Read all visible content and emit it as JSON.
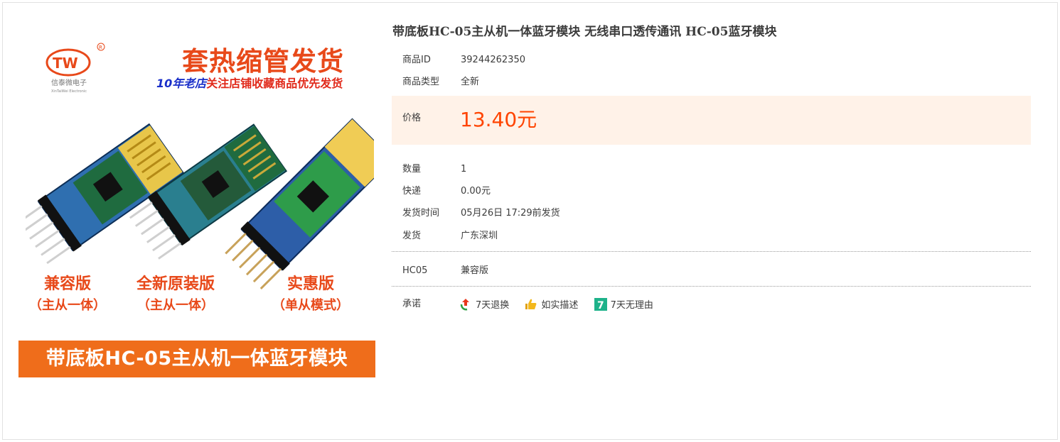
{
  "product": {
    "title": "带底板HC-05主从机一体蓝牙模块 无线串口透传通讯 HC-05蓝牙模块",
    "image": {
      "logo_text": "TW",
      "logo_cn": "信泰微电子",
      "logo_en": "XinTaiWei Electronic",
      "promo_title": "套热缩管发货",
      "promo_sub_blue": "10年老店",
      "promo_sub_red": "关注店铺收藏商品优先发货",
      "captions": [
        {
          "big": "兼容版",
          "small": "（主从一体）"
        },
        {
          "big": "全新原装版",
          "small": "（主从一体）"
        },
        {
          "big": "实惠版",
          "small": "（单从模式）"
        }
      ],
      "banner": "带底板HC-05主从机一体蓝牙模块"
    }
  },
  "details": {
    "item_id_label": "商品ID",
    "item_id": "39244262350",
    "type_label": "商品类型",
    "type": "全新",
    "price_label": "价格",
    "price": "13.40元",
    "qty_label": "数量",
    "qty": "1",
    "shipping_label": "快递",
    "shipping": "0.00元",
    "ship_time_label": "发货时间",
    "ship_time": "05月26日 17:29前发货",
    "origin_label": "发货",
    "origin": "广东深圳",
    "variant_label": "HC05",
    "variant": "兼容版",
    "promise_label": "承诺",
    "promises": [
      {
        "icon": "return-icon",
        "label": "7天退换"
      },
      {
        "icon": "thumb-icon",
        "label": "如实描述"
      },
      {
        "icon": "seven-day-icon",
        "label": "7天无理由"
      }
    ]
  },
  "colors": {
    "price": "#ff4400",
    "price_bg": "#fff2e8",
    "banner": "#ef6d1b",
    "promo": "#e8491a"
  }
}
